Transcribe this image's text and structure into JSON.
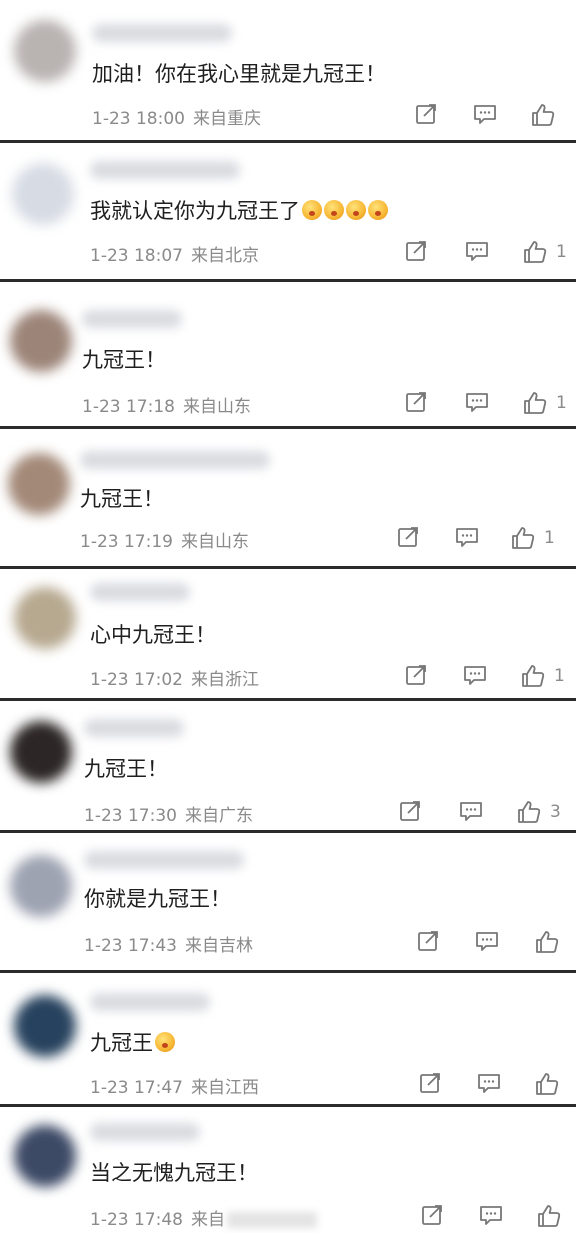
{
  "comments": [
    {
      "text": "加油！你在我心里就是九冠王！",
      "emoji_count": 0,
      "time": "1-23 18:00",
      "location": "来自重庆",
      "likes": "",
      "avatar_color": "#b9b3b1"
    },
    {
      "text": "我就认定你为九冠王了",
      "emoji_count": 4,
      "time": "1-23 18:07",
      "location": "来自北京",
      "likes": "1",
      "avatar_color": "#d7dce4"
    },
    {
      "text": "九冠王！",
      "emoji_count": 0,
      "time": "1-23 17:18",
      "location": "来自山东",
      "likes": "1",
      "avatar_color": "#9c8478"
    },
    {
      "text": "九冠王！",
      "emoji_count": 0,
      "time": "1-23 17:19",
      "location": "来自山东",
      "likes": "1",
      "avatar_color": "#a38978"
    },
    {
      "text": "心中九冠王！",
      "emoji_count": 0,
      "time": "1-23 17:02",
      "location": "来自浙江",
      "likes": "1",
      "avatar_color": "#b7a990"
    },
    {
      "text": "九冠王！",
      "emoji_count": 0,
      "time": "1-23 17:30",
      "location": "来自广东",
      "likes": "3",
      "avatar_color": "#2c2626"
    },
    {
      "text": "你就是九冠王！",
      "emoji_count": 0,
      "time": "1-23 17:43",
      "location": "来自吉林",
      "likes": "",
      "avatar_color": "#9ea3b2"
    },
    {
      "text": "九冠王",
      "emoji_count": 1,
      "time": "1-23 17:47",
      "location": "来自江西",
      "likes": "",
      "avatar_color": "#27425e"
    },
    {
      "text": "当之无愧九冠王！",
      "emoji_count": 0,
      "time": "1-23 17:48",
      "location": "来自",
      "likes": "",
      "avatar_color": "#3d4a66"
    }
  ],
  "icons": {
    "share": "share-icon",
    "comment": "comment-icon",
    "like": "thumbs-up-icon"
  }
}
